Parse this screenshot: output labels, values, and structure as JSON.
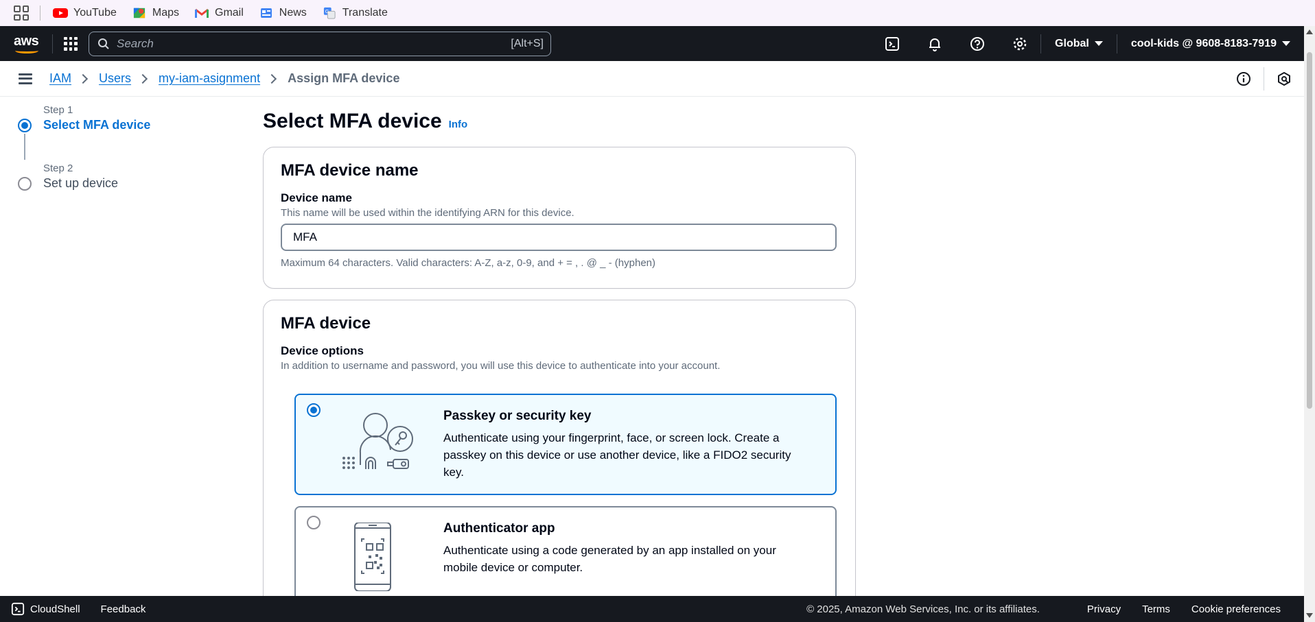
{
  "bookmarks": [
    {
      "label": "YouTube",
      "icon": "youtube-icon"
    },
    {
      "label": "Maps",
      "icon": "maps-icon"
    },
    {
      "label": "Gmail",
      "icon": "gmail-icon"
    },
    {
      "label": "News",
      "icon": "news-icon"
    },
    {
      "label": "Translate",
      "icon": "translate-icon"
    }
  ],
  "topnav": {
    "search_placeholder": "Search",
    "search_shortcut": "[Alt+S]",
    "region": "Global",
    "account": "cool-kids @ 9608-8183-7919"
  },
  "breadcrumb": {
    "items": [
      "IAM",
      "Users",
      "my-iam-asignment"
    ],
    "current": "Assign MFA device"
  },
  "steps": [
    {
      "label": "Step 1",
      "name": "Select MFA device",
      "active": true
    },
    {
      "label": "Step 2",
      "name": "Set up device",
      "active": false
    }
  ],
  "main": {
    "title": "Select MFA device",
    "info_link": "Info",
    "name_card": {
      "heading": "MFA device name",
      "field_label": "Device name",
      "field_desc": "This name will be used within the identifying ARN for this device.",
      "value": "MFA",
      "hint": "Maximum 64 characters. Valid characters: A-Z, a-z, 0-9, and + = , . @ _ - (hyphen)"
    },
    "device_card": {
      "heading": "MFA device",
      "options_label": "Device options",
      "options_desc": "In addition to username and password, you will use this device to authenticate into your account.",
      "options": [
        {
          "title": "Passkey or security key",
          "desc": "Authenticate using your fingerprint, face, or screen lock. Create a passkey on this device or use another device, like a FIDO2 security key.",
          "selected": true
        },
        {
          "title": "Authenticator app",
          "desc": "Authenticate using a code generated by an app installed on your mobile device or computer.",
          "selected": false
        }
      ]
    }
  },
  "footer": {
    "cloudshell": "CloudShell",
    "feedback": "Feedback",
    "copyright": "© 2025, Amazon Web Services, Inc. or its affiliates.",
    "privacy": "Privacy",
    "terms": "Terms",
    "cookies": "Cookie preferences"
  },
  "colors": {
    "accent": "#0972d3",
    "nav_bg": "#16191f",
    "aws_orange": "#ff9900",
    "selected_bg": "#f0fbff"
  }
}
